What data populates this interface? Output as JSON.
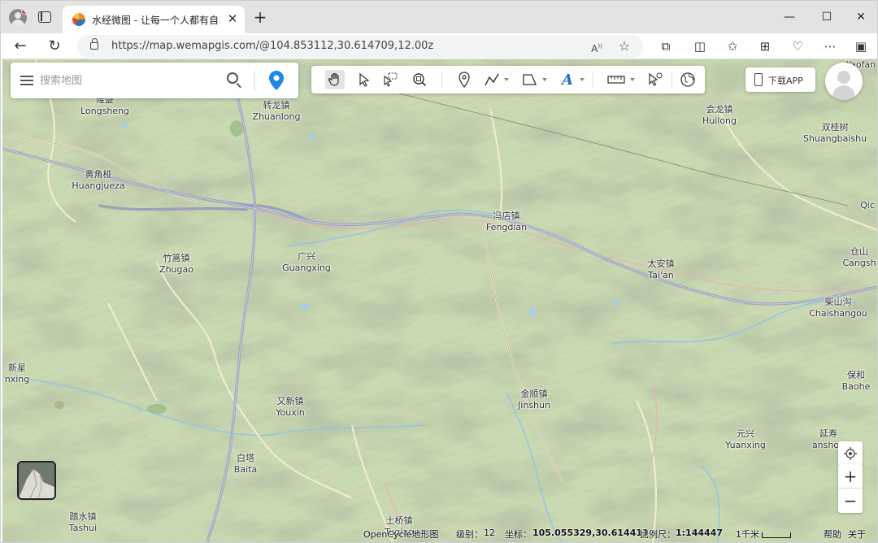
{
  "browser": {
    "tab_title": "水经微图 - 让每一个人都有自己的",
    "url": "https://map.wemapgis.com/@104.853112,30.614709,12.00z",
    "window_controls": [
      "—",
      "☐",
      "✕"
    ]
  },
  "search": {
    "placeholder": "搜索地图"
  },
  "toolbar": {
    "tools": [
      "pan-hand-icon",
      "select-arrow-icon",
      "box-select-icon",
      "zoom-box-icon",
      "marker-icon",
      "polyline-icon",
      "polygon-icon",
      "text-icon",
      "ruler-icon",
      "pointer-info-icon",
      "globe-icon"
    ],
    "active_tool": "pan-hand-icon"
  },
  "download_button": {
    "label": "下载APP"
  },
  "places": [
    {
      "cn": "隆盛",
      "en": "Longsheng"
    },
    {
      "cn": "转龙镇",
      "en": "Zhuanlong"
    },
    {
      "cn": "会龙镇",
      "en": "Huilong"
    },
    {
      "cn": "双桂树",
      "en": "Shuangbaishu"
    },
    {
      "cn": "黄角桠",
      "en": "Huangjueza"
    },
    {
      "cn": "冯店镇",
      "en": "Fengdian"
    },
    {
      "cn": "竹篙镇",
      "en": "Zhugao"
    },
    {
      "cn": "广兴",
      "en": "Guangxing"
    },
    {
      "cn": "太安镇",
      "en": "Tai'an"
    },
    {
      "cn": "仓山",
      "en": "Cangsh"
    },
    {
      "cn": "柴山沟",
      "en": "Chaishangou"
    },
    {
      "cn": "新星",
      "en": "nxing"
    },
    {
      "cn": "金顺镇",
      "en": "Jinshun"
    },
    {
      "cn": "又新镇",
      "en": "Youxin"
    },
    {
      "cn": "保和",
      "en": "Baohe"
    },
    {
      "cn": "元兴",
      "en": "Yuanxing"
    },
    {
      "cn": "延寿",
      "en": "anshou"
    },
    {
      "cn": "白塔",
      "en": "Baita"
    },
    {
      "cn": "踏水镇",
      "en": "Tashui"
    },
    {
      "cn": "土桥镇",
      "en": "Tuqiao"
    },
    {
      "cn": "",
      "en": "Qic"
    },
    {
      "cn": "",
      "en": "Yaofan"
    }
  ],
  "status": {
    "layer_name": "OpenCycle地形图",
    "zoom_label": "级别：",
    "zoom_value": "12",
    "coord_label": "坐标：",
    "coord_value": "105.055329,30.614413",
    "scale_label": "比例尺：",
    "scale_value": "1:144447",
    "scale_bar_label": "1千米",
    "help": "帮助",
    "about": "关于"
  },
  "colors": {
    "map_base": "#c9d9b1",
    "road_main": "#a7acc6",
    "road_minor": "#f2ecd0",
    "water": "#8fc4e6",
    "accent_blue": "#1e88e5"
  }
}
